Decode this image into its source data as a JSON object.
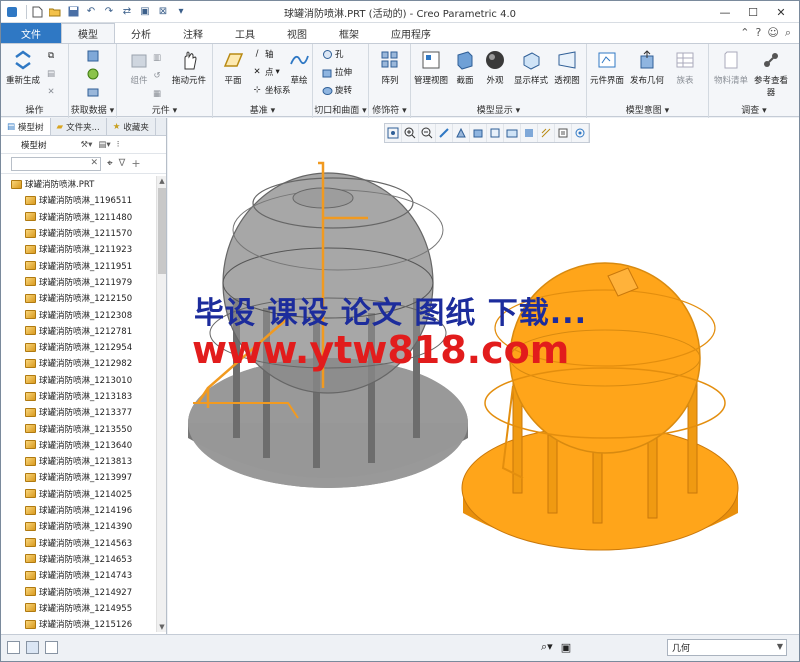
{
  "window": {
    "title": "球罐消防喷淋.PRT (活动的) - Creo Parametric 4.0"
  },
  "ribbon": {
    "tabs": [
      "文件",
      "模型",
      "分析",
      "注释",
      "工具",
      "视图",
      "框架",
      "应用程序"
    ],
    "active_tab": "模型",
    "groups": {
      "operations": {
        "label": "操作",
        "regenerate": "重新生成"
      },
      "get_data": {
        "label": "获取数据",
        "component_interface": "组件"
      },
      "elements": {
        "label": "元件",
        "drag": "拖动元件"
      },
      "datum": {
        "label": "基准",
        "plane": "平面",
        "axis": "轴",
        "point": "点",
        "csys": "坐标系",
        "sketch": "草绘"
      },
      "cut_surface": {
        "label": "切口和曲面",
        "hole": "孔",
        "extrude": "拉伸",
        "revolve": "旋转"
      },
      "modifiers": {
        "label": "修饰符",
        "pattern": "阵列"
      },
      "model_display": {
        "label": "模型显示",
        "manage_views": "管理视图",
        "section": "截面",
        "appearance": "外观",
        "display_style": "显示样式",
        "perspective": "透视图"
      },
      "model_intent": {
        "label": "模型意图",
        "component_interface": "元件界面",
        "publish_geometry": "发布几何",
        "table": "族表"
      },
      "investigate": {
        "label": "调查",
        "bill_of_materials": "物料清单",
        "reference_viewer": "参考查看器"
      }
    }
  },
  "left_panel": {
    "tabs": [
      "模型树",
      "文件夹...",
      "收藏夹"
    ],
    "toolbar_label": "模型树",
    "root": "球罐消防喷淋.PRT",
    "items": [
      "球罐消防喷淋_1196511",
      "球罐消防喷淋_1211480",
      "球罐消防喷淋_1211570",
      "球罐消防喷淋_1211923",
      "球罐消防喷淋_1211951",
      "球罐消防喷淋_1211979",
      "球罐消防喷淋_1212150",
      "球罐消防喷淋_1212308",
      "球罐消防喷淋_1212781",
      "球罐消防喷淋_1212954",
      "球罐消防喷淋_1212982",
      "球罐消防喷淋_1213010",
      "球罐消防喷淋_1213183",
      "球罐消防喷淋_1213377",
      "球罐消防喷淋_1213550",
      "球罐消防喷淋_1213640",
      "球罐消防喷淋_1213813",
      "球罐消防喷淋_1213997",
      "球罐消防喷淋_1214025",
      "球罐消防喷淋_1214196",
      "球罐消防喷淋_1214390",
      "球罐消防喷淋_1214563",
      "球罐消防喷淋_1214653",
      "球罐消防喷淋_1214743",
      "球罐消防喷淋_1214927",
      "球罐消防喷淋_1214955",
      "球罐消防喷淋_1215126"
    ]
  },
  "viewport": {
    "watermark_line1": "毕设 课设 论文 图纸 下载...",
    "watermark_line2": "www.ytw818.com",
    "colors": {
      "gray_model": "#8c8c8c",
      "orange_model": "#ffa51a",
      "watermark_blue": "#1c2c9c",
      "watermark_red": "#e21c1c"
    }
  },
  "status_bar": {
    "filter_value": "几何"
  }
}
